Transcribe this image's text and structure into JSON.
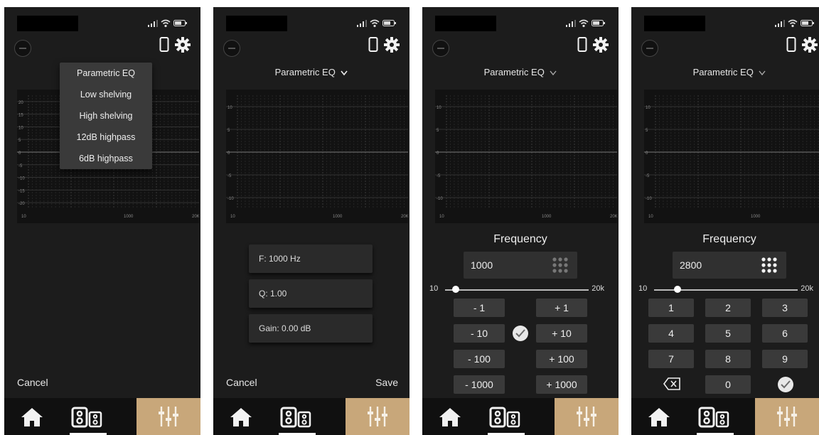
{
  "colors": {
    "accent": "#c8a77a",
    "background": "#1c1c1c",
    "chart_bg": "#121212"
  },
  "screen1": {
    "menu": [
      "Parametric EQ",
      "Low shelving",
      "High shelving",
      "12dB highpass",
      "6dB highpass"
    ],
    "y_ticks": [
      "20",
      "15",
      "10",
      "5",
      "0",
      "-5",
      "-10",
      "-15",
      "-20"
    ],
    "x_ticks": [
      "10",
      "1000",
      "20K"
    ],
    "cancel": "Cancel"
  },
  "screen2": {
    "filter_type": "Parametric EQ",
    "y_ticks": [
      "10",
      "5",
      "0",
      "-5",
      "-10"
    ],
    "x_ticks": [
      "10",
      "1000",
      "20K"
    ],
    "params": [
      "F: 1000 Hz",
      "Q: 1.00",
      "Gain: 0.00 dB"
    ],
    "cancel": "Cancel",
    "save": "Save"
  },
  "screen3": {
    "filter_type": "Parametric EQ",
    "y_ticks": [
      "10",
      "5",
      "0",
      "-5",
      "-10"
    ],
    "x_ticks": [
      "10",
      "1000",
      "20K"
    ],
    "freq_label": "Frequency",
    "freq_value": "1000",
    "slider_min": "10",
    "slider_max": "20k",
    "slider_fraction": 0.05,
    "steps": [
      "- 1",
      "+ 1",
      "- 10",
      "+ 10",
      "- 100",
      "+ 100",
      "- 1000",
      "+ 1000"
    ]
  },
  "screen4": {
    "filter_type": "Parametric EQ",
    "y_ticks": [
      "10",
      "5",
      "0",
      "-5",
      "-10"
    ],
    "x_ticks": [
      "10",
      "1000",
      "20K"
    ],
    "freq_label": "Frequency",
    "freq_value": "2800",
    "slider_min": "10",
    "slider_max": "20k",
    "slider_fraction": 0.14,
    "keys": [
      "1",
      "2",
      "3",
      "4",
      "5",
      "6",
      "7",
      "8",
      "9",
      "0"
    ]
  },
  "icons": {
    "signal": "signal-icon",
    "wifi": "wifi-icon",
    "battery": "battery-icon",
    "phone": "phone-icon",
    "gear": "gear-icon",
    "home": "home-icon",
    "speakers": "speakers-icon",
    "equalizer": "equalizer-icon",
    "chevron": "chevron-down-icon",
    "keypad": "keypad-icon",
    "check": "check-icon",
    "backspace": "backspace-icon"
  }
}
